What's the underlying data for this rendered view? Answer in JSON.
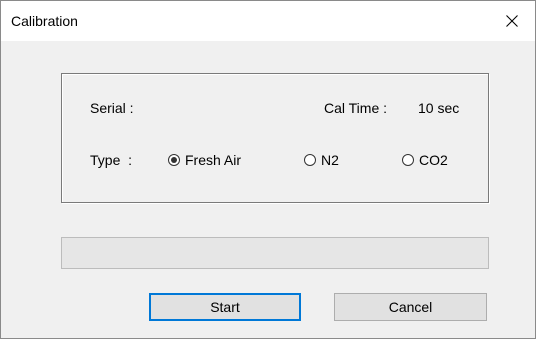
{
  "window": {
    "title": "Calibration"
  },
  "form": {
    "serial_label": "Serial :",
    "serial_value": "",
    "cal_time_label": "Cal Time :",
    "cal_time_value": "10 sec",
    "type_label": "Type  :",
    "type_options": [
      {
        "label": "Fresh Air",
        "checked": true
      },
      {
        "label": "N2",
        "checked": false
      },
      {
        "label": "CO2",
        "checked": false
      }
    ]
  },
  "progress": {
    "value": 0
  },
  "buttons": {
    "start_label": "Start",
    "cancel_label": "Cancel"
  },
  "colors": {
    "accent": "#0078d7",
    "progress_fill": "#06b025"
  },
  "icons": {
    "close": "close-icon"
  }
}
